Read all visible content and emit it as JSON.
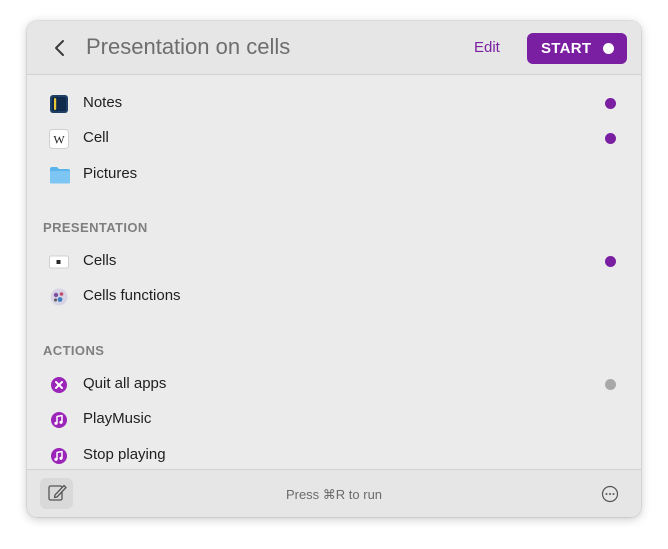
{
  "header": {
    "back_icon": "chevron-left-icon",
    "title": "Presentation on cells",
    "edit_label": "Edit",
    "start_label": "START"
  },
  "items": [
    {
      "label": "Notes",
      "icon": "notes-app-icon",
      "status": "active"
    },
    {
      "label": "Cell",
      "icon": "wikipedia-icon",
      "status": "active"
    },
    {
      "label": "Pictures",
      "icon": "folder-icon",
      "status": "none"
    }
  ],
  "presentation": {
    "title": "PRESENTATION",
    "items": [
      {
        "label": "Cells",
        "icon": "keynote-document-icon",
        "status": "active"
      },
      {
        "label": "Cells functions",
        "icon": "cells-image-icon",
        "status": "none"
      }
    ]
  },
  "actions": {
    "title": "ACTIONS",
    "items": [
      {
        "label": "Quit all apps",
        "icon": "quit-circle-icon",
        "status": "inactive"
      },
      {
        "label": "PlayMusic",
        "icon": "music-note-icon",
        "status": "none"
      },
      {
        "label": "Stop playing",
        "icon": "music-note-icon",
        "status": "none"
      }
    ]
  },
  "footer": {
    "hint": "Press ⌘R to run",
    "compose_icon": "compose-icon",
    "more_icon": "ellipsis-circle-icon"
  },
  "colors": {
    "accent": "#7a1fa2",
    "status_active": "#7a1fa2",
    "status_inactive": "#a8a8a8",
    "window_bg": "#ebebeb"
  }
}
